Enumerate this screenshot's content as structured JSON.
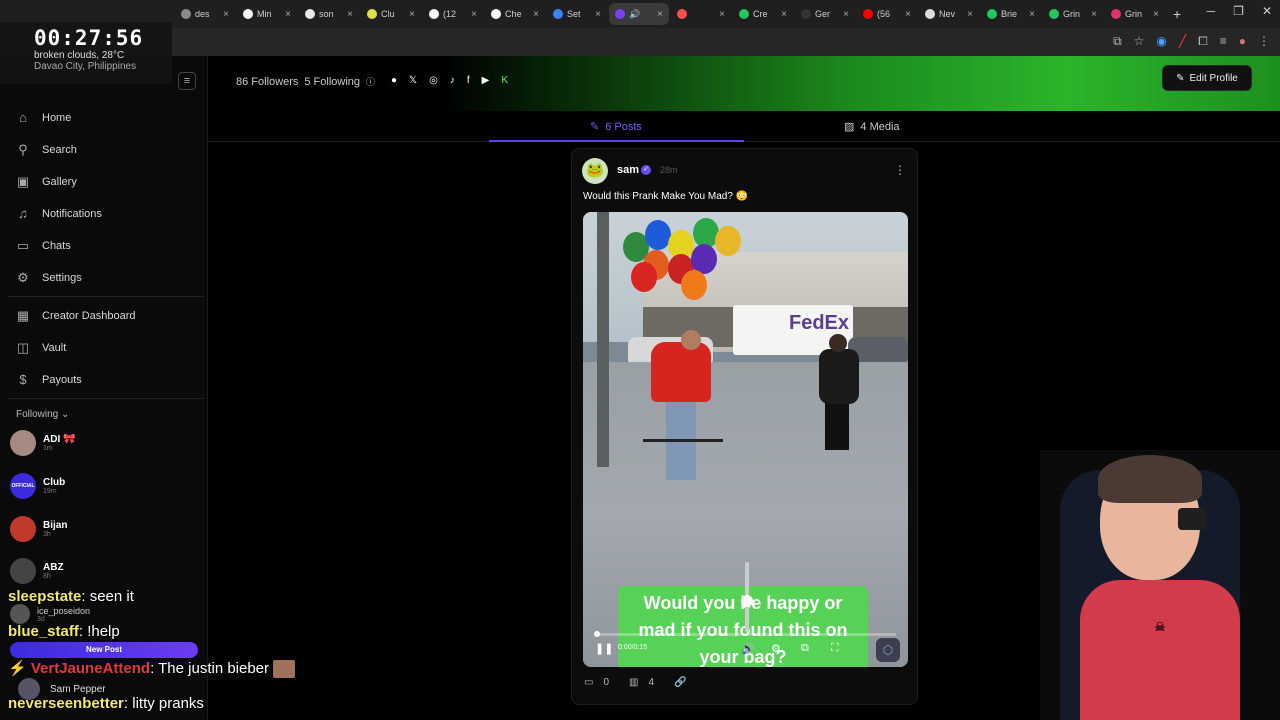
{
  "browser": {
    "tabs": [
      {
        "label": "des",
        "color": "#8a8a8a"
      },
      {
        "label": "Min",
        "color": "#ffffff"
      },
      {
        "label": "son",
        "color": "#e8e8e8"
      },
      {
        "label": "Clu",
        "color": "#e0e048"
      },
      {
        "label": "(12",
        "color": "#ffffff"
      },
      {
        "label": "Che",
        "color": "#ffffff"
      },
      {
        "label": "Set",
        "color": "#3b82f6"
      },
      {
        "label": "",
        "color": "#7b3ff2"
      },
      {
        "label": "",
        "color": "#ff4d4d"
      },
      {
        "label": "Cre",
        "color": "#22c55e"
      },
      {
        "label": "Ger",
        "color": "#333333"
      },
      {
        "label": "(56",
        "color": "#ff0000"
      },
      {
        "label": "Nev",
        "color": "#dddddd"
      },
      {
        "label": "Brie",
        "color": "#22c55e"
      },
      {
        "label": "Grin",
        "color": "#22c55e"
      },
      {
        "label": "Grin",
        "color": "#e1306c"
      }
    ],
    "new_tab": "+"
  },
  "clock": {
    "time": "00:27:56",
    "weather": "broken clouds, 28°C",
    "location": "Davao City, Philippines"
  },
  "sidebar": {
    "items": [
      {
        "label": "Home",
        "icon": "home-icon"
      },
      {
        "label": "Search",
        "icon": "search-icon"
      },
      {
        "label": "Gallery",
        "icon": "gallery-icon"
      },
      {
        "label": "Notifications",
        "icon": "bell-icon"
      },
      {
        "label": "Chats",
        "icon": "chat-icon"
      },
      {
        "label": "Settings",
        "icon": "gear-icon"
      }
    ],
    "creator_items": [
      {
        "label": "Creator Dashboard",
        "icon": "dashboard-icon"
      },
      {
        "label": "Vault",
        "icon": "vault-icon"
      },
      {
        "label": "Payouts",
        "icon": "dollar-icon"
      }
    ],
    "following_label": "Following",
    "following": [
      {
        "name": "ADI 🎀",
        "time": "1m",
        "color": "#a58a82"
      },
      {
        "name": "Club",
        "time": "19m",
        "color": "#3b2be0",
        "badge": "OFFICIAL"
      },
      {
        "name": "Bijan",
        "time": "3h",
        "color": "#c0392b"
      },
      {
        "name": "ABZ",
        "time": "8h",
        "color": "#444444"
      },
      {
        "name": "ice_poseidon",
        "time": "3d",
        "color": "#555555"
      }
    ],
    "new_post": "New Post",
    "current_user": "Sam Pepper"
  },
  "chat": [
    {
      "user": "sleepstate",
      "color": "#f2e96b",
      "msg": ": seen it"
    },
    {
      "user": "blue_staff",
      "color": "#f2e96b",
      "msg": ": !help"
    },
    {
      "user": "VertJauneAttend",
      "color": "#e03a3a",
      "msg": ": The justin bieber"
    },
    {
      "user": "neverseenbetter",
      "color": "#f2e96b",
      "msg": ": litty pranks"
    }
  ],
  "profile": {
    "followers": "86 Followers",
    "following": "5 Following",
    "edit_profile": "Edit Profile",
    "socials": [
      "snapchat-icon",
      "x-icon",
      "instagram-icon",
      "tiktok-icon",
      "facebook-icon",
      "youtube-icon",
      "kick-icon"
    ]
  },
  "tabs": {
    "posts": "6 Posts",
    "media": "4 Media",
    "active_color": "#6a4cf7"
  },
  "post": {
    "author": "sam",
    "age": "28m",
    "caption": "Would this Prank Make You Mad? 😳",
    "video_text": "Would you be happy or mad if you found this on your bag?",
    "video_time": "0:00/0:15",
    "truck_brand": "FedEx",
    "comments": "0",
    "views": "4"
  }
}
